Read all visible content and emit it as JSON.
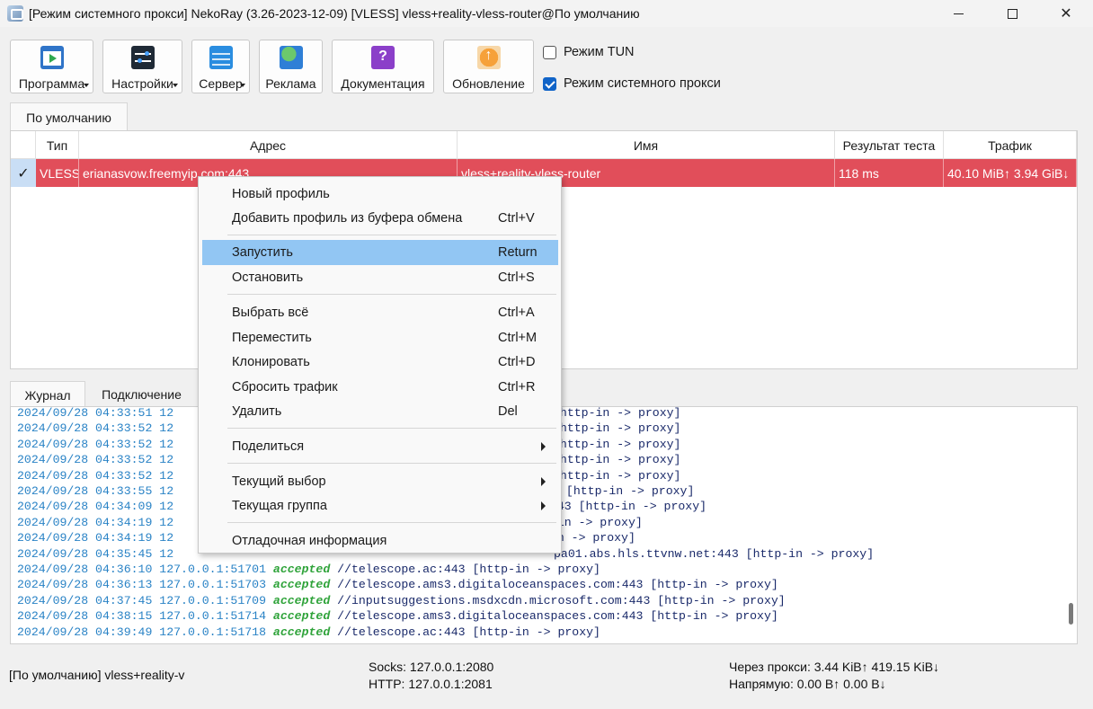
{
  "window": {
    "title": "[Режим системного прокси] NekoRay (3.26-2023-12-09) [VLESS] vless+reality-vless-router@По умолчанию"
  },
  "toolbar": {
    "buttons": [
      {
        "label": "Программа",
        "icon": "program-icon",
        "dropdown": true
      },
      {
        "label": "Настройки",
        "icon": "settings-icon",
        "dropdown": true
      },
      {
        "label": "Сервер",
        "icon": "server-icon",
        "dropdown": true
      },
      {
        "label": "Реклама",
        "icon": "globe-icon",
        "dropdown": false
      },
      {
        "label": "Документация",
        "icon": "help-icon",
        "dropdown": false
      },
      {
        "label": "Обновление",
        "icon": "update-icon",
        "dropdown": false
      }
    ],
    "tun_mode": {
      "label": "Режим TUN",
      "checked": false
    },
    "system_proxy": {
      "label": "Режим системного прокси",
      "checked": true
    }
  },
  "group_tab": "По умолчанию",
  "table": {
    "columns": [
      "Тип",
      "Адрес",
      "Имя",
      "Результат теста",
      "Трафик"
    ],
    "rows": [
      {
        "selected_mark": "✓",
        "type": "VLESS",
        "address": "erianasvow.freemyip.com:443",
        "name": "vless+reality-vless-router",
        "test": "118 ms",
        "traffic": "40.10 MiB↑ 3.94 GiB↓"
      }
    ]
  },
  "context_menu": {
    "items": [
      {
        "label": "Новый профиль",
        "shortcut": ""
      },
      {
        "label": "Добавить профиль из буфера обмена",
        "shortcut": "Ctrl+V"
      },
      {
        "label": "Запустить",
        "shortcut": "Return",
        "highlighted": true
      },
      {
        "label": "Остановить",
        "shortcut": "Ctrl+S"
      },
      {
        "label": "Выбрать всё",
        "shortcut": "Ctrl+A"
      },
      {
        "label": "Переместить",
        "shortcut": "Ctrl+M"
      },
      {
        "label": "Клонировать",
        "shortcut": "Ctrl+D"
      },
      {
        "label": "Сбросить трафик",
        "shortcut": "Ctrl+R"
      },
      {
        "label": "Удалить",
        "shortcut": "Del"
      },
      {
        "label": "Поделиться",
        "shortcut": "",
        "submenu": true
      },
      {
        "label": "Текущий выбор",
        "shortcut": "",
        "submenu": true
      },
      {
        "label": "Текущая группа",
        "shortcut": "",
        "submenu": true
      },
      {
        "label": "Отладочная информация",
        "shortcut": ""
      }
    ]
  },
  "log_tabs": [
    "Журнал",
    "Подключение"
  ],
  "log": [
    {
      "ts": "2024/09/28 04:33:51",
      "rest": " 12",
      "tail": "[http-in -> proxy]"
    },
    {
      "ts": "2024/09/28 04:33:52",
      "rest": " 12",
      "tail": "[http-in -> proxy]"
    },
    {
      "ts": "2024/09/28 04:33:52",
      "rest": " 12",
      "tail": "[http-in -> proxy]"
    },
    {
      "ts": "2024/09/28 04:33:52",
      "rest": " 12",
      "tail": "[http-in -> proxy]"
    },
    {
      "ts": "2024/09/28 04:33:52",
      "rest": " 12",
      "tail": "[http-in -> proxy]"
    },
    {
      "ts": "2024/09/28 04:33:55",
      "rest": " 12",
      "tail": " [http-in -> proxy]"
    },
    {
      "ts": "2024/09/28 04:34:09",
      "rest": " 12",
      "tail": ":443 [http-in -> proxy]"
    },
    {
      "ts": "2024/09/28 04:34:19",
      "rest": " 12",
      "tail": "p-in -> proxy]"
    },
    {
      "ts": "2024/09/28 04:34:19",
      "rest": " 12",
      "tail": "-in -> proxy]"
    },
    {
      "ts": "2024/09/28 04:35:45",
      "rest": " 12",
      "tail": "pa01.abs.hls.ttvnw.net:443 [http-in -> proxy]"
    },
    {
      "ts": "2024/09/28 04:36:10",
      "rest": " 127.0.0.1:51701 ",
      "acc": "accepted",
      "tail": " //telescope.ac:443 [http-in -> proxy]"
    },
    {
      "ts": "2024/09/28 04:36:13",
      "rest": " 127.0.0.1:51703 ",
      "acc": "accepted",
      "tail": " //telescope.ams3.digitaloceanspaces.com:443 [http-in -> proxy]"
    },
    {
      "ts": "2024/09/28 04:37:45",
      "rest": " 127.0.0.1:51709 ",
      "acc": "accepted",
      "tail": " //inputsuggestions.msdxcdn.microsoft.com:443 [http-in -> proxy]"
    },
    {
      "ts": "2024/09/28 04:38:15",
      "rest": " 127.0.0.1:51714 ",
      "acc": "accepted",
      "tail": " //telescope.ams3.digitaloceanspaces.com:443 [http-in -> proxy]"
    },
    {
      "ts": "2024/09/28 04:39:49",
      "rest": " 127.0.0.1:51718 ",
      "acc": "accepted",
      "tail": " //telescope.ac:443 [http-in -> proxy]"
    }
  ],
  "statusbar": {
    "profile": "[По умолчанию] vless+reality-v",
    "socks": "Socks: 127.0.0.1:2080",
    "http": "HTTP: 127.0.0.1:2081",
    "via_proxy": "Через прокси: 3.44 KiB↑ 419.15 KiB↓",
    "direct": "Напрямую: 0.00 B↑ 0.00 B↓"
  }
}
